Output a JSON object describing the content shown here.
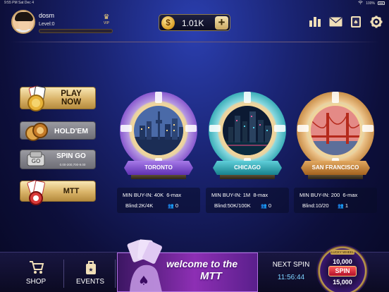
{
  "status_bar": {
    "time": "9:55 PM",
    "date": "Sat Dec 4",
    "battery": "100%"
  },
  "header": {
    "username": "dosm",
    "level": "Level:0",
    "vip_label": "VIP",
    "coin_symbol": "$",
    "coins": "1.01K",
    "plus_label": "+",
    "icons": [
      "leaderboard-icon",
      "mail-icon",
      "cards-book-icon",
      "settings-icon"
    ]
  },
  "menu": {
    "play_now": "PLAY NOW",
    "holdem": "HOLD'EM",
    "spin_go": "SPIN GO",
    "spin_go_sub": "0.00-200,700-9.00",
    "mtt": "MTT"
  },
  "tables": [
    {
      "city": "TORONTO",
      "min_buyin": "MIN BUY-IN: 40K",
      "max": "6-max",
      "blind": "Blind:2K/4K",
      "players": "0",
      "accent": "#8a52d8"
    },
    {
      "city": "CHICAGO",
      "min_buyin": "MIN BUY-IN: 1M",
      "max": "8-max",
      "blind": "Blind:50K/100K",
      "players": "0",
      "accent": "#2aa7b3"
    },
    {
      "city": "SAN FRANCISCO",
      "min_buyin": "MIN BUY-IN: 200",
      "max": "6-max",
      "blind": "Blind:10/20",
      "players": "1",
      "accent": "#c98a3c"
    }
  ],
  "bottom": {
    "shop": "SHOP",
    "events": "EVENTS",
    "banner_line1": "welcome to the",
    "banner_line2": "MTT",
    "next_spin_label": "NEXT SPIN",
    "next_spin_time": "11:56:44",
    "wheel_top": "10,000",
    "wheel_button": "SPIN",
    "wheel_bottom": "15,000",
    "wheel_tag": "LUCKY WHEEL"
  }
}
